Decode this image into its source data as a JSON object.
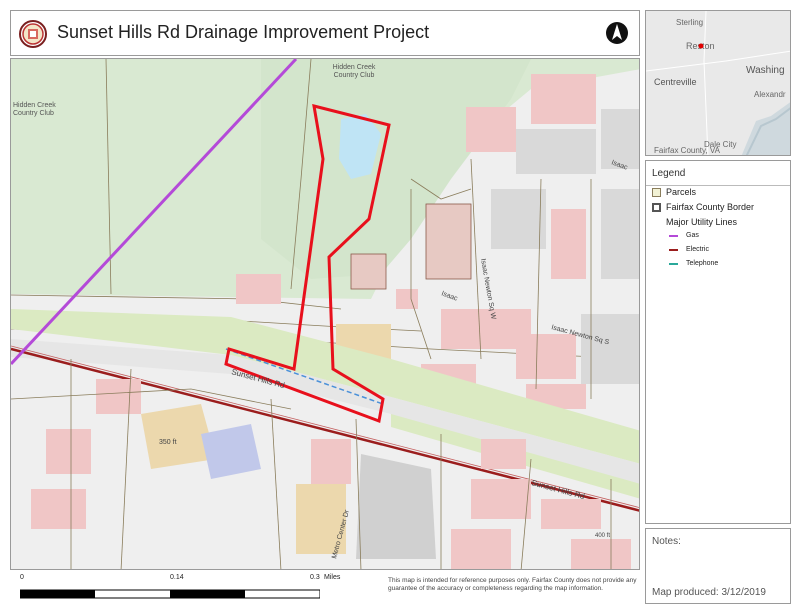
{
  "title": "Sunset Hills Rd Drainage Improvement Project",
  "main_map": {
    "labels": {
      "club_top": "Hidden Creek\nCountry Club",
      "club_left": "Hidden Creek\nCountry Club",
      "sunset_hills_rd_1": "Sunset Hills Rd",
      "sunset_hills_rd_2": "Sunset Hills Rd",
      "isaac_newton_sq_w": "Isaac Newton Sq W",
      "isaac_newton_sq_s": "Isaac Newton Sq S",
      "isaac_top": "Isaac",
      "isaac_mid": "Isaac",
      "metro_center_dr": "Metro Center Dr",
      "building_350": "350 ft",
      "building_400": "400 ft"
    }
  },
  "inset_map": {
    "labels": {
      "sterling": "Sterling",
      "reston": "Reston",
      "centreville": "Centreville",
      "washington": "Washing",
      "alexandria": "Alexandr",
      "fairfax_county": "Fairfax County, VA",
      "dale": "Dale City"
    },
    "marker_color": "#e00000"
  },
  "legend": {
    "title": "Legend",
    "parcels": "Parcels",
    "border": "Fairfax County Border",
    "utility_heading": "Major Utility Lines",
    "gas": "Gas",
    "electric": "Electric",
    "telephone": "Telephone",
    "colors": {
      "parcels_fill": "#f2f2d5",
      "parcels_stroke": "#8a7d5c",
      "border": "#555555",
      "gas": "#b44ad8",
      "electric": "#9b1d1d",
      "telephone": "#2aa89a"
    }
  },
  "notes": {
    "label": "Notes:",
    "map_produced": "Map produced:   3/12/2019"
  },
  "scalebar": {
    "label_0": "0",
    "label_mid": "0.14",
    "label_end": "0.3",
    "units": "Miles"
  },
  "disclaimer": "This map is intended for reference purposes only. Fairfax County does not provide any guarantee of the accuracy or completeness regarding the map information.",
  "colors": {
    "project_outline": "#e8101c",
    "woods": "#d9e9d2",
    "road_buffer": "#dbeac2",
    "building": "#f0c6c6",
    "building_dark": "#d7d7d7",
    "tan_building": "#ecd8ad",
    "water": "#bfe4f5",
    "blue_building": "#c1c8ea"
  }
}
